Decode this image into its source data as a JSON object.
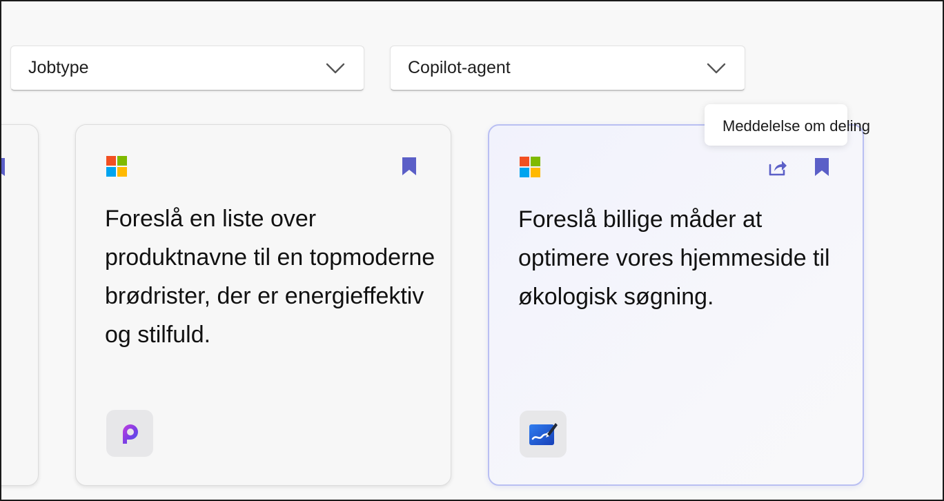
{
  "filters": {
    "job_type": {
      "label": "Jobtype",
      "icon": "chevron-down-icon"
    },
    "copilot_agent": {
      "label": "Copilot-agent",
      "icon": "chevron-down-icon"
    }
  },
  "cards": [
    {
      "text": "Foreslå en liste over produktnavne til en topmoderne brødrister, der er energieffektiv og stilfuld.",
      "icons": [
        "microsoft-logo-icon",
        "bookmark-icon",
        "copilot-app-icon"
      ]
    },
    {
      "text": "Foreslå billige måder at optimere vores hjemmeside til økologisk søgning.",
      "icons": [
        "microsoft-logo-icon",
        "share-icon",
        "bookmark-icon",
        "whiteboard-app-icon"
      ]
    }
  ],
  "tooltip": {
    "text": "Meddelelse om deling"
  },
  "colors": {
    "accent": "#5b5fc7",
    "card_selected_border": "#b9bff2",
    "ms_red": "#f25022",
    "ms_green": "#7fba00",
    "ms_blue": "#00a4ef",
    "ms_yellow": "#ffb900"
  }
}
